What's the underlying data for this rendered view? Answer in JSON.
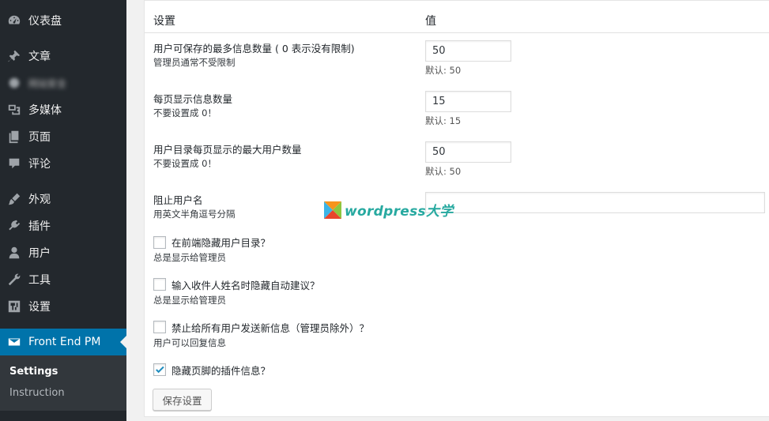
{
  "sidebar": {
    "items": [
      {
        "label": "仪表盘",
        "icon": "dashboard-icon"
      },
      {
        "label": "文章",
        "icon": "pin-icon"
      },
      {
        "label": "网站安全",
        "icon": "blurred-icon"
      },
      {
        "label": "多媒体",
        "icon": "media-icon"
      },
      {
        "label": "页面",
        "icon": "page-icon"
      },
      {
        "label": "评论",
        "icon": "comment-icon"
      },
      {
        "label": "外观",
        "icon": "appearance-icon"
      },
      {
        "label": "插件",
        "icon": "plugin-icon"
      },
      {
        "label": "用户",
        "icon": "user-icon"
      },
      {
        "label": "工具",
        "icon": "wrench-icon"
      },
      {
        "label": "设置",
        "icon": "settings-icon"
      }
    ],
    "active": {
      "label": "Front End PM",
      "icon": "mail-icon"
    },
    "submenu": [
      {
        "label": "Settings"
      },
      {
        "label": "Instruction"
      }
    ]
  },
  "table": {
    "col_setting": "设置",
    "col_value": "值"
  },
  "rows": [
    {
      "label": "用户可保存的最多信息数量 ( 0 表示没有限制)",
      "desc": "管理员通常不受限制",
      "value": "50",
      "default": "默认: 50"
    },
    {
      "label": "每页显示信息数量",
      "desc": "不要设置成 0！",
      "value": "15",
      "default": "默认: 15"
    },
    {
      "label": "用户目录每页显示的最大用户数量",
      "desc": "不要设置成 0！",
      "value": "50",
      "default": "默认: 50"
    },
    {
      "label": "阻止用户名",
      "desc": "用英文半角逗号分隔",
      "value": "",
      "default": ""
    }
  ],
  "checkboxes": [
    {
      "label": "在前端隐藏用户目录？",
      "desc": "总是显示给管理员",
      "checked": false
    },
    {
      "label": "输入收件人姓名时隐藏自动建议？",
      "desc": "总是显示给管理员",
      "checked": false
    },
    {
      "label": "禁止给所有用户发送新信息（管理员除外）？",
      "desc": "用户可以回复信息",
      "checked": false
    },
    {
      "label": "隐藏页脚的插件信息？",
      "desc": "",
      "checked": true
    }
  ],
  "save_label": "保存设置",
  "watermark": {
    "text": "wordpress大学"
  },
  "colors": {
    "sidebar_bg": "#23282d",
    "active_bg": "#0073aa",
    "check": "#1e8cbe",
    "watermark": "#27a9a0"
  }
}
